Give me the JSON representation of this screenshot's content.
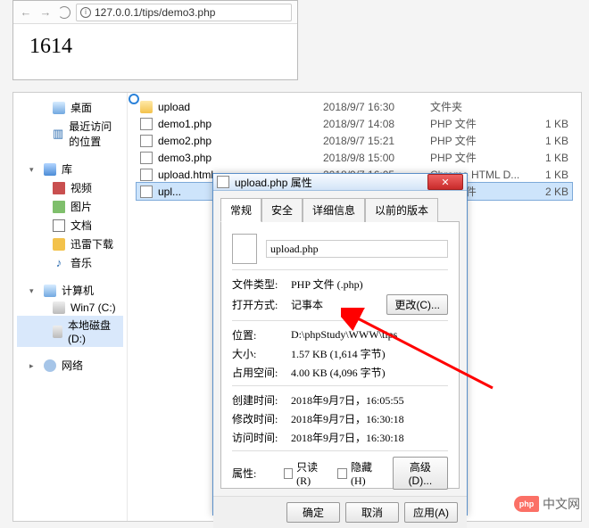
{
  "browser": {
    "url": "127.0.0.1/tips/demo3.php",
    "page_content": "1614"
  },
  "sidebar": {
    "items": [
      {
        "label": "桌面",
        "icon": "desktop-icon"
      },
      {
        "label": "最近访问的位置",
        "icon": "recent-icon"
      },
      {
        "label": "库",
        "icon": "library-icon"
      },
      {
        "label": "视频",
        "icon": "video-icon"
      },
      {
        "label": "图片",
        "icon": "picture-icon"
      },
      {
        "label": "文档",
        "icon": "document-icon"
      },
      {
        "label": "迅雷下载",
        "icon": "download-icon"
      },
      {
        "label": "音乐",
        "icon": "music-icon"
      },
      {
        "label": "计算机",
        "icon": "computer-icon"
      },
      {
        "label": "Win7 (C:)",
        "icon": "disk-icon"
      },
      {
        "label": "本地磁盘 (D:)",
        "icon": "disk-icon",
        "selected": true
      },
      {
        "label": "网络",
        "icon": "network-icon"
      }
    ]
  },
  "files": [
    {
      "name": "upload",
      "date": "2018/9/7 16:30",
      "type": "文件夹",
      "size": "",
      "kind": "fld"
    },
    {
      "name": "demo1.php",
      "date": "2018/9/7 14:08",
      "type": "PHP 文件",
      "size": "1 KB",
      "kind": "php"
    },
    {
      "name": "demo2.php",
      "date": "2018/9/7 15:21",
      "type": "PHP 文件",
      "size": "1 KB",
      "kind": "php"
    },
    {
      "name": "demo3.php",
      "date": "2018/9/8 15:00",
      "type": "PHP 文件",
      "size": "1 KB",
      "kind": "php"
    },
    {
      "name": "upload.html",
      "date": "2018/9/7 16:05",
      "type": "Chrome HTML D...",
      "size": "1 KB",
      "kind": "html"
    },
    {
      "name": "upl...",
      "date": "",
      "type": "PHP 文件",
      "size": "2 KB",
      "kind": "php",
      "selected": true
    }
  ],
  "dialog": {
    "title": "upload.php 属性",
    "tabs": [
      "常规",
      "安全",
      "详细信息",
      "以前的版本"
    ],
    "filename": "upload.php",
    "rows": {
      "file_type_label": "文件类型:",
      "file_type_value": "PHP 文件 (.php)",
      "open_with_label": "打开方式:",
      "open_with_value": "记事本",
      "change_btn": "更改(C)...",
      "location_label": "位置:",
      "location_value": "D:\\phpStudy\\WWW\\tips",
      "size_label": "大小:",
      "size_value": "1.57 KB (1,614 字节)",
      "size_disk_label": "占用空间:",
      "size_disk_value": "4.00 KB (4,096 字节)",
      "created_label": "创建时间:",
      "created_value": "2018年9月7日，16:05:55",
      "modified_label": "修改时间:",
      "modified_value": "2018年9月7日，16:30:18",
      "accessed_label": "访问时间:",
      "accessed_value": "2018年9月7日，16:30:18",
      "attr_label": "属性:",
      "readonly_label": "只读(R)",
      "hidden_label": "隐藏(H)",
      "advanced_btn": "高级(D)..."
    },
    "buttons": {
      "ok": "确定",
      "cancel": "取消",
      "apply": "应用(A)"
    }
  },
  "logo": {
    "badge": "php",
    "text": "中文网"
  }
}
